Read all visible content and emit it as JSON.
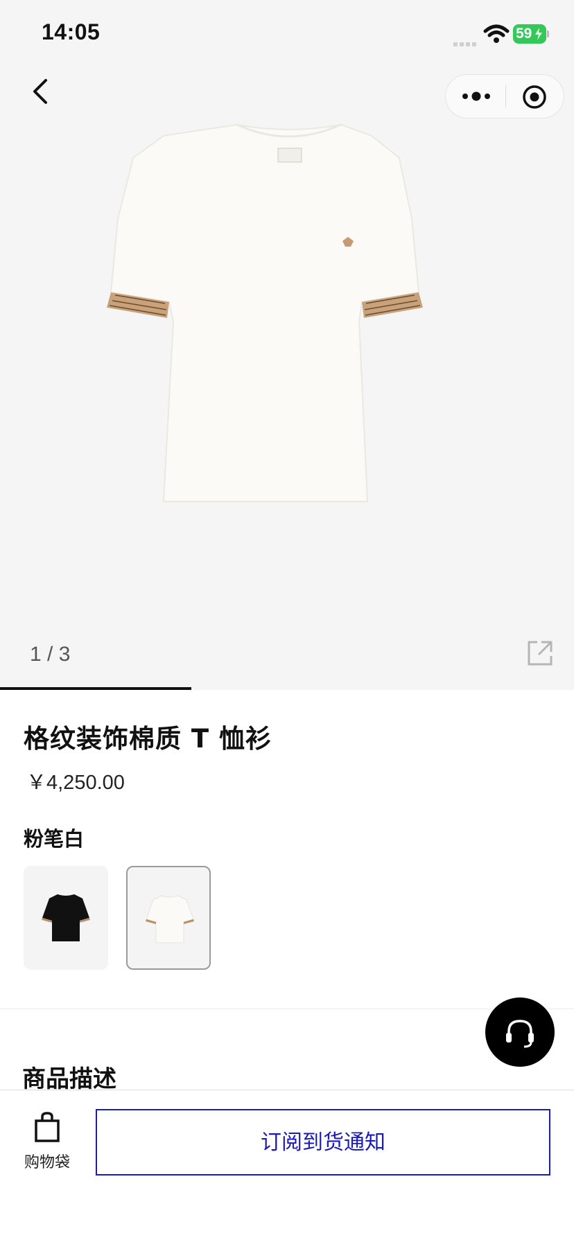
{
  "status_bar": {
    "time": "14:05",
    "battery": "59"
  },
  "gallery": {
    "counter": "1 / 3",
    "progress": 0.333
  },
  "product": {
    "title": "格纹装饰棉质 T 恤衫",
    "price": "￥4,250.00",
    "color_name": "粉笔白",
    "swatches": [
      {
        "color": "#111111",
        "selected": false
      },
      {
        "color": "#fbfaf6",
        "selected": true
      }
    ]
  },
  "sections": {
    "description_heading": "商品描述"
  },
  "bottom_bar": {
    "bag_label": "购物袋",
    "notify_label": "订阅到货通知"
  },
  "colors": {
    "accent": "#1a1ab5",
    "battery": "#34c759",
    "shirt": "#fbfaf6"
  }
}
